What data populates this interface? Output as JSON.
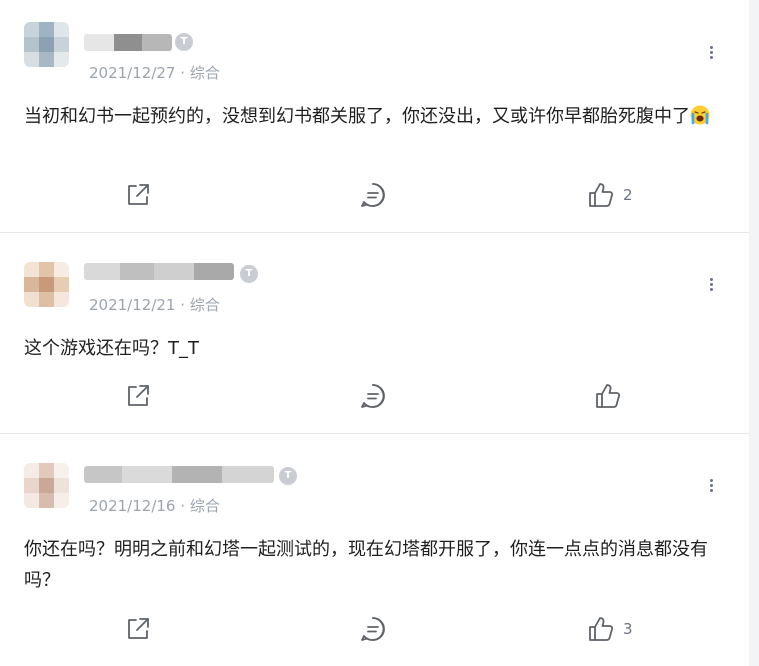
{
  "posts": [
    {
      "date": "2021/12/27",
      "category": "综合",
      "meta_sep": "·",
      "content": "当初和幻书一起预约的，没想到幻书都关服了，你还没出，又或许你早都胎死腹中了",
      "emoji_icon": "loudly-crying-face-icon",
      "like_count": "2",
      "badge_letter": "T"
    },
    {
      "date": "2021/12/21",
      "category": "综合",
      "meta_sep": "·",
      "content": "这个游戏还在吗？T_T",
      "like_count": "",
      "badge_letter": "T"
    },
    {
      "date": "2021/12/16",
      "category": "综合",
      "meta_sep": "·",
      "content": "你还在吗？明明之前和幻塔一起测试的，现在幻塔都开服了，你连一点点的消息都没有吗？",
      "like_count": "3",
      "badge_letter": "T"
    }
  ],
  "icons": {
    "share": "share-icon",
    "comment": "comment-icon",
    "like": "thumbs-up-icon",
    "more": "more-vertical-icon"
  },
  "colors": {
    "text": "#1f1f1f",
    "meta": "#9ca3af",
    "icon": "#5f6368",
    "divider": "#e8e8e8"
  }
}
